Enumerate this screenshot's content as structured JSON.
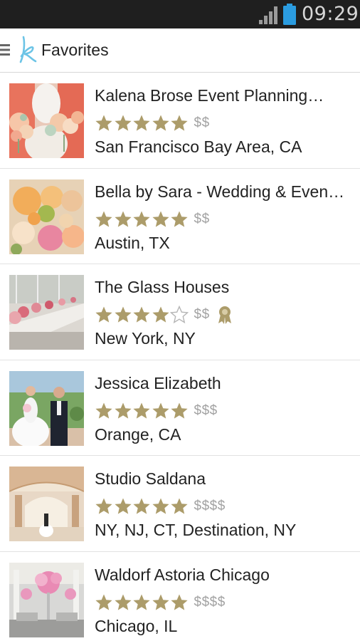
{
  "status_bar": {
    "time": "09:29"
  },
  "header": {
    "title": "Favorites",
    "logo_letter": "k"
  },
  "colors": {
    "star": "#ac9c6a",
    "price": "#a2a2a2",
    "logo": "#6cc4e6",
    "battery": "#2b9ce0"
  },
  "vendors": [
    {
      "name": "Kalena Brose Event Planning…",
      "stars": 5,
      "price": "$$",
      "location": "San Francisco Bay Area, CA",
      "award": false
    },
    {
      "name": "Bella by Sara - Wedding & Even…",
      "stars": 5,
      "price": "$$",
      "location": "Austin, TX",
      "award": false
    },
    {
      "name": "The Glass Houses",
      "stars": 4,
      "price": "$$",
      "location": "New York, NY",
      "award": true
    },
    {
      "name": "Jessica Elizabeth",
      "stars": 5,
      "price": "$$$",
      "location": "Orange, CA",
      "award": false
    },
    {
      "name": "Studio Saldana",
      "stars": 5,
      "price": "$$$$",
      "location": "NY, NJ, CT, Destination, NY",
      "award": false
    },
    {
      "name": "Waldorf Astoria Chicago",
      "stars": 5,
      "price": "$$$$",
      "location": "Chicago, IL",
      "award": false
    }
  ]
}
